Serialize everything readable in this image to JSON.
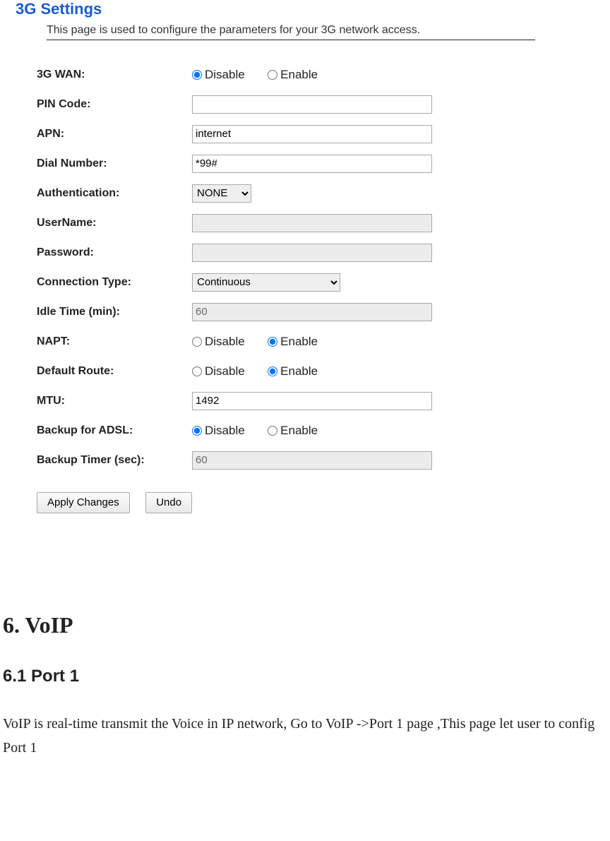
{
  "panel": {
    "title": "3G Settings",
    "description": "This page is used to configure the parameters for your 3G network access."
  },
  "fields": {
    "wan": {
      "label": "3G WAN:",
      "disable": "Disable",
      "enable": "Enable"
    },
    "pin": {
      "label": "PIN Code:",
      "value": ""
    },
    "apn": {
      "label": "APN:",
      "value": "internet"
    },
    "dial": {
      "label": "Dial Number:",
      "value": "*99#"
    },
    "auth": {
      "label": "Authentication:",
      "value": "NONE"
    },
    "user": {
      "label": "UserName:",
      "value": ""
    },
    "pass": {
      "label": "Password:",
      "value": ""
    },
    "conn": {
      "label": "Connection Type:",
      "value": "Continuous"
    },
    "idle": {
      "label": "Idle Time (min):",
      "value": "60"
    },
    "napt": {
      "label": "NAPT:",
      "disable": "Disable",
      "enable": "Enable"
    },
    "route": {
      "label": "Default Route:",
      "disable": "Disable",
      "enable": "Enable"
    },
    "mtu": {
      "label": "MTU:",
      "value": "1492"
    },
    "adsl": {
      "label": "Backup for ADSL:",
      "disable": "Disable",
      "enable": "Enable"
    },
    "btimer": {
      "label": "Backup Timer (sec):",
      "value": "60"
    }
  },
  "buttons": {
    "apply": "Apply Changes",
    "undo": "Undo"
  },
  "doc": {
    "heading": "6. VoIP",
    "subheading": "6.1 Port 1",
    "para": "VoIP is real-time transmit the Voice in IP network, Go to VoIP ->Port 1 page ,This page let user to config Port 1"
  }
}
